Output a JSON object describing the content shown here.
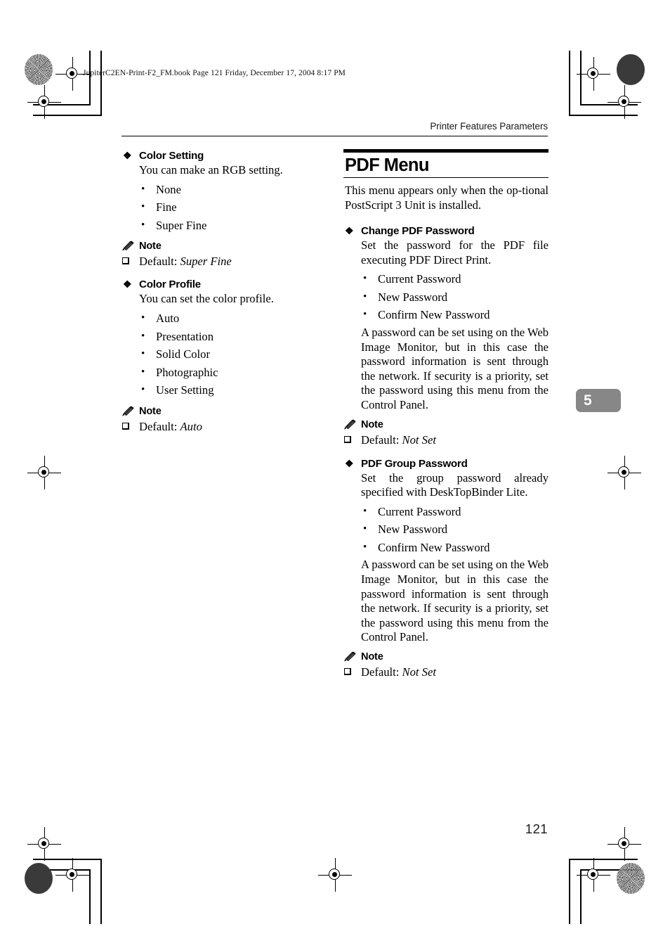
{
  "file_stamp": "JupiterC2EN-Print-F2_FM.book  Page 121  Friday, December 17, 2004  8:17 PM",
  "running_head": "Printer Features Parameters",
  "chapter_tab": "5",
  "folio": "121",
  "icons": {
    "diamond": "❖",
    "round_bullet": "•",
    "square_bullet": "square-outline",
    "pencil": "pencil-icon"
  },
  "note_label": "Note",
  "default_prefix": "Default: ",
  "left_column": {
    "sections": [
      {
        "title": "Color Setting",
        "description": "You can make an RGB setting.",
        "options": [
          "None",
          "Fine",
          "Super Fine"
        ],
        "note": {
          "label": "Note",
          "default_label": "Default: ",
          "default_value": "Super Fine"
        }
      },
      {
        "title": "Color Profile",
        "description": "You can set the color profile.",
        "options": [
          "Auto",
          "Presentation",
          "Solid Color",
          "Photographic",
          "User Setting"
        ],
        "note": {
          "label": "Note",
          "default_label": "Default: ",
          "default_value": "Auto"
        }
      }
    ]
  },
  "right_column": {
    "chapter_title": "PDF Menu",
    "intro": "This menu appears only when the op-tional PostScript 3 Unit is installed.",
    "sections": [
      {
        "title": "Change PDF Password",
        "description": "Set the password for the PDF file executing PDF Direct Print.",
        "options": [
          "Current Password",
          "New Password",
          "Confirm New Password"
        ],
        "paragraph": "A password can be set using on the Web Image Monitor, but in this case the password information is sent through the network. If security is a priority, set the password using this menu from the Control Panel.",
        "note": {
          "label": "Note",
          "default_label": "Default: ",
          "default_value": "Not Set"
        }
      },
      {
        "title": "PDF Group Password",
        "description": "Set the group password already specified with DeskTopBinder Lite.",
        "options": [
          "Current Password",
          "New Password",
          "Confirm New Password"
        ],
        "paragraph": "A password can be set using on the Web Image Monitor, but in this case the password information is sent through the network. If security is a priority, set the password using this menu from the Control Panel.",
        "note": {
          "label": "Note",
          "default_label": "Default: ",
          "default_value": "Not Set"
        }
      }
    ]
  }
}
